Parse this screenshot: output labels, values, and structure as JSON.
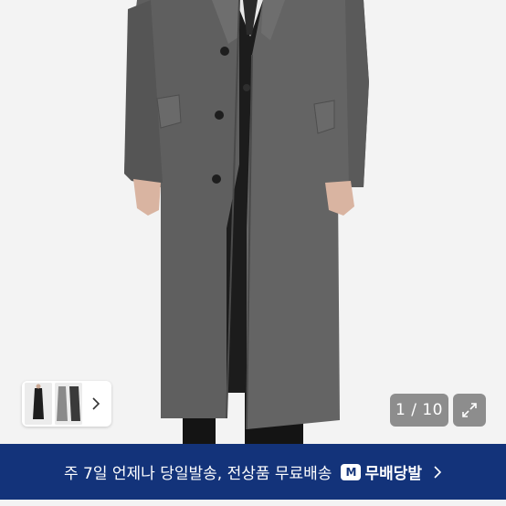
{
  "gallery": {
    "counter": "1 / 10",
    "main_image": "gray-long-wool-coat-photo",
    "thumbnails": [
      "black-coat-thumbnail",
      "gray-coat-thumbnail"
    ],
    "next_icon": "chevron-right-icon",
    "expand_icon": "expand-arrows-icon"
  },
  "banner": {
    "text": "주 7일 언제나 당일발송, 전상품 무료배송",
    "badge_letter": "M",
    "brand": "무배당발",
    "icon": "chevron-right-icon",
    "background": "#13337a"
  }
}
